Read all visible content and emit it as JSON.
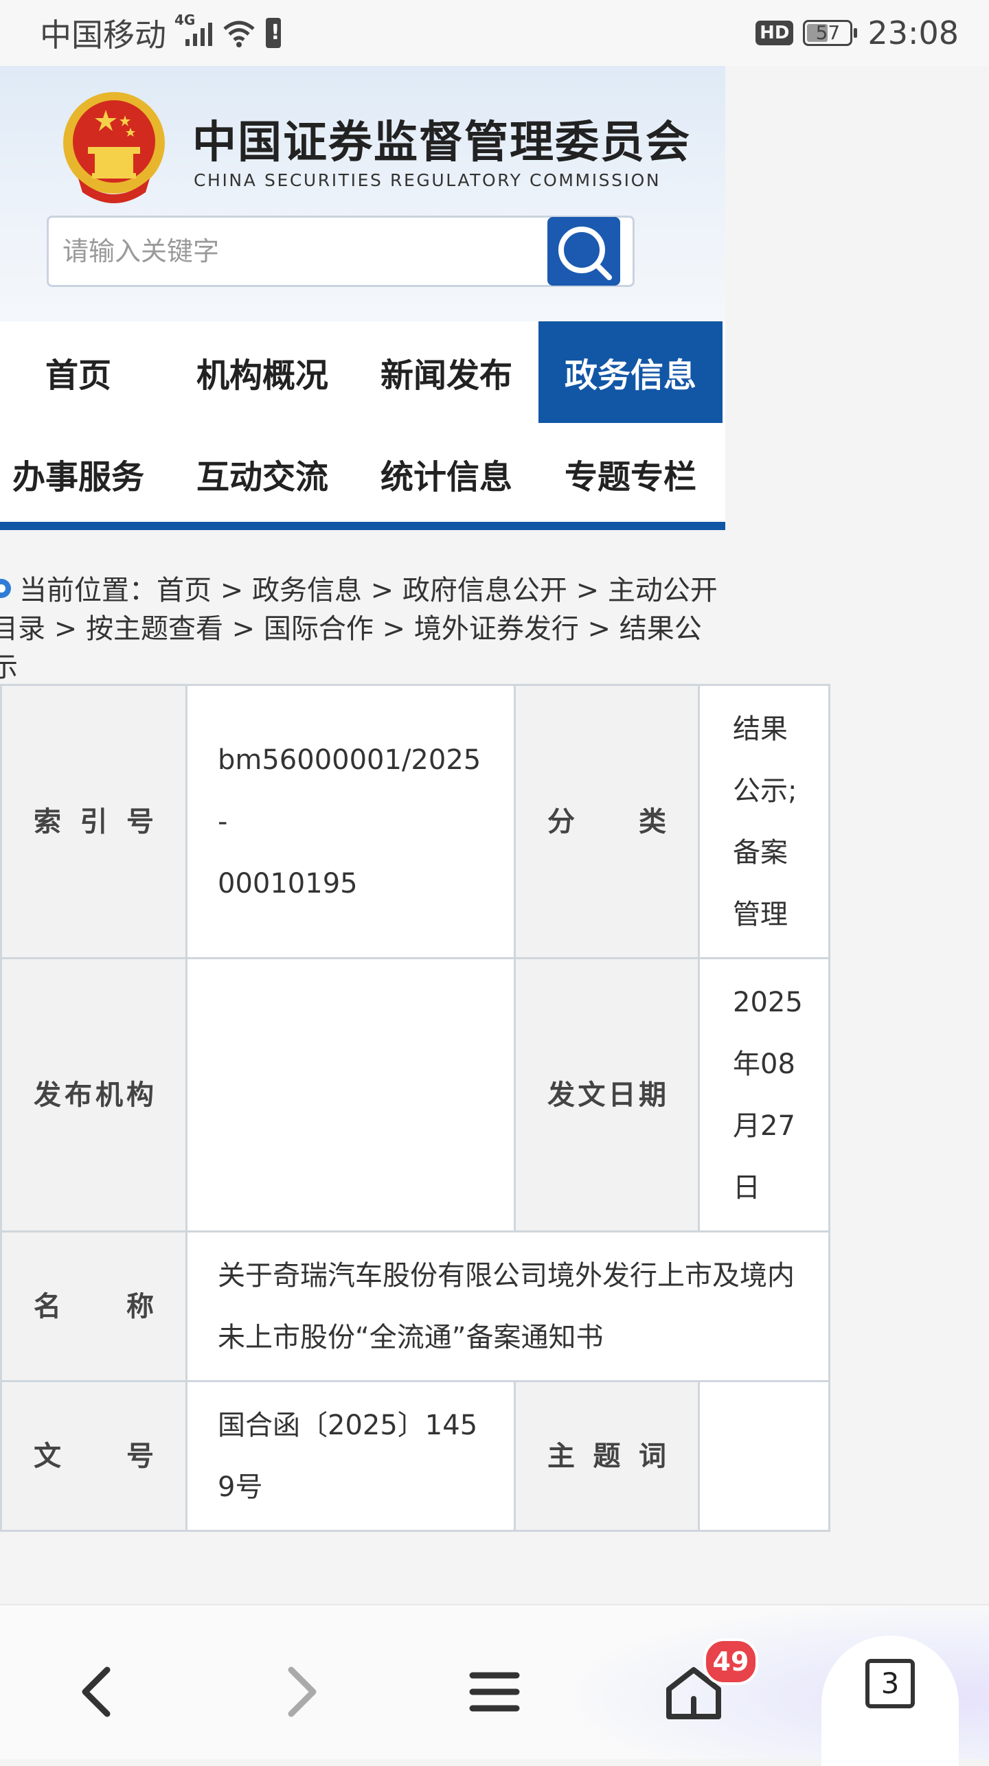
{
  "status_bar": {
    "carrier": "中国移动",
    "network": "4G",
    "hd": "HD",
    "battery": "57",
    "time": "23:08"
  },
  "header": {
    "title": "中国证券监督管理委员会",
    "subtitle": "CHINA SECURITIES REGULATORY COMMISSION",
    "search_placeholder": "请输入关键字"
  },
  "nav": {
    "items": [
      "首页",
      "机构概况",
      "新闻发布",
      "政务信息",
      "办事服务",
      "互动交流",
      "统计信息",
      "专题专栏"
    ],
    "active": "政务信息"
  },
  "breadcrumb": {
    "line1": "当前位置：首页 > 政务信息 > 政府信息公开 > 主动公开",
    "line2": "目录 > 按主题查看 > 国际合作 > 境外证券发行 > 结果公示"
  },
  "info_table": {
    "index_label": "索引号",
    "index_value_1": "bm56000001/2025-",
    "index_value_2": "00010195",
    "category_label": "分类",
    "category_value": "结果公示;备案管理",
    "publisher_label": "发布机构",
    "publisher_value": "",
    "date_label": "发文日期",
    "date_value": "2025年08月27日",
    "name_label": "名称",
    "name_value": "关于奇瑞汽车股份有限公司境外发行上市及境内未上市股份“全流通”备案通知书",
    "docno_label": "文号",
    "docno_value": "国合函〔2025〕1459号",
    "subject_label": "主题词",
    "subject_value": ""
  },
  "toolbar": {
    "back": "back-icon",
    "forward": "forward-icon",
    "menu": "menu-icon",
    "home": "home-icon",
    "home_badge": "49",
    "tabs_count": "3"
  },
  "colors": {
    "nav_active": "#1256a6",
    "badge": "#e8424a",
    "search_button": "#1b5ab0"
  }
}
